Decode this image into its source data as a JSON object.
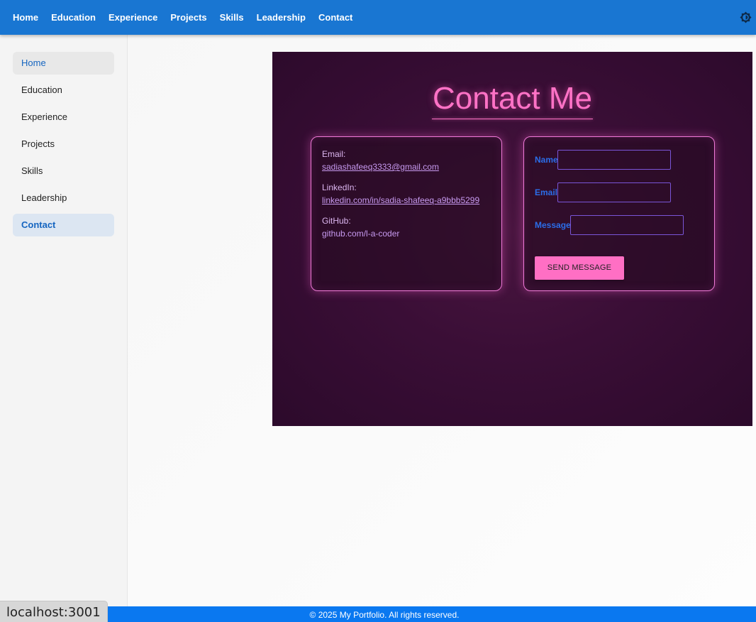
{
  "navbar": {
    "items": [
      "Home",
      "Education",
      "Experience",
      "Projects",
      "Skills",
      "Leadership",
      "Contact"
    ],
    "theme_icon": "brightness-icon"
  },
  "sidebar": {
    "items": [
      "Home",
      "Education",
      "Experience",
      "Projects",
      "Skills",
      "Leadership",
      "Contact"
    ],
    "hovered": "Home",
    "active": "Contact"
  },
  "contact": {
    "title": "Contact Me",
    "email_label": "Email:",
    "email_value": "sadiashafeeq3333@gmail.com",
    "linkedin_label": "LinkedIn:",
    "linkedin_value": "linkedin.com/in/sadia-shafeeq-a9bbb5299",
    "github_label": "GitHub:",
    "github_value": "github.com/l-a-coder",
    "form": {
      "name_label": "Name",
      "name_value": "",
      "email_label": "Email",
      "email_value": "",
      "message_label": "Message",
      "message_value": "",
      "send_label": "SEND MESSAGE"
    }
  },
  "footer": {
    "text": "© 2025 My Portfolio. All rights reserved."
  },
  "status_bar": {
    "url": "localhost:3001"
  },
  "colors": {
    "appbar": "#1976d2",
    "accent_pink": "#ff72c6",
    "section_bg": "#3a0e36",
    "footer": "#0a78f0",
    "form_label": "#2b6de8"
  }
}
